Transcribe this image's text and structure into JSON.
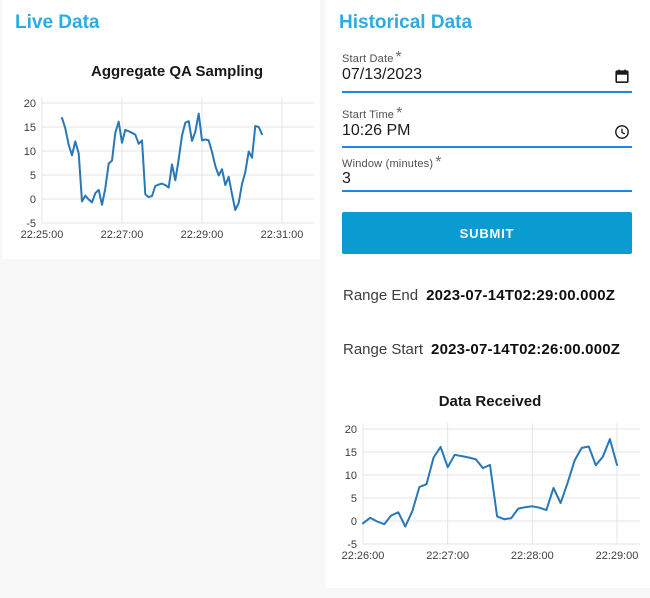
{
  "left_panel": {
    "heading": "Live Data"
  },
  "right_panel": {
    "heading": "Historical Data",
    "form": {
      "start_date": {
        "label": "Start Date",
        "required_marker": "*",
        "value": "07/13/2023"
      },
      "start_time": {
        "label": "Start Time",
        "required_marker": "*",
        "value": "10:26 PM"
      },
      "window": {
        "label": "Window (minutes)",
        "required_marker": "*",
        "value": "3"
      },
      "submit_label": "SUBMIT"
    },
    "range_end": {
      "label": "Range End",
      "value": "2023-07-14T02:29:00.000Z"
    },
    "range_start": {
      "label": "Range Start",
      "value": "2023-07-14T02:26:00.000Z"
    }
  },
  "icons": {
    "date_picker": "calendar-icon",
    "time_picker": "clock-icon"
  },
  "colors": {
    "heading_accent": "#2bace3",
    "underline_accent": "#1e88e5",
    "submit_bg": "#0a9bd0",
    "submit_text": "#ffffff",
    "chart_line": "#2878b8",
    "grid_line": "#e4e4e4",
    "page_bg": "#f8f8f8",
    "card_bg": "#ffffff"
  },
  "chart_data": [
    {
      "type": "line",
      "name": "aggregate-qa-sampling",
      "title": "Aggregate QA Sampling",
      "start_time": "22:25:30",
      "interval_seconds": 5,
      "x_range": [
        "22:25:00",
        "22:31:00"
      ],
      "x_ticks": [
        "22:25:00",
        "22:27:00",
        "22:29:00",
        "22:31:00"
      ],
      "y_ticks": [
        20,
        15,
        10,
        5,
        0,
        -5
      ],
      "y_range": [
        -5,
        20
      ],
      "line_color": "#2878b8",
      "values": [
        16.9,
        14.7,
        11.3,
        9.1,
        12.0,
        9.5,
        -0.5,
        0.7,
        -0.1,
        -0.7,
        1.2,
        1.9,
        -1.2,
        2.2,
        7.4,
        8.0,
        13.8,
        16.1,
        11.7,
        14.4,
        14.1,
        13.8,
        13.4,
        11.5,
        12.2,
        1.0,
        0.4,
        0.6,
        2.7,
        3.0,
        3.2,
        2.9,
        2.4,
        7.2,
        3.9,
        8.3,
        13.2,
        15.9,
        16.2,
        12.1,
        14.0,
        17.8,
        12.2,
        12.4,
        12.2,
        9.8,
        6.9,
        4.9,
        6.2,
        2.9,
        4.6,
        1.0,
        -2.3,
        -0.8,
        3.1,
        5.6,
        9.9,
        8.6,
        15.2,
        15.0,
        13.5
      ]
    },
    {
      "type": "line",
      "name": "data-received",
      "title": "Data Received",
      "start_time": "22:26:00",
      "interval_seconds": 5,
      "x_range": [
        "22:26:00",
        "22:29:00"
      ],
      "x_ticks": [
        "22:26:00",
        "22:27:00",
        "22:28:00",
        "22:29:00"
      ],
      "y_ticks": [
        20,
        15,
        10,
        5,
        0,
        -5
      ],
      "y_range": [
        -5,
        20
      ],
      "line_color": "#2878b8",
      "values": [
        -0.5,
        0.7,
        -0.1,
        -0.7,
        1.2,
        1.9,
        -1.2,
        2.2,
        7.4,
        8.0,
        13.8,
        16.1,
        11.7,
        14.4,
        14.1,
        13.8,
        13.4,
        11.5,
        12.2,
        1.0,
        0.4,
        0.6,
        2.7,
        3.0,
        3.2,
        2.9,
        2.4,
        7.2,
        3.9,
        8.3,
        13.2,
        15.9,
        16.2,
        12.1,
        14.0,
        17.8,
        12.2
      ]
    }
  ]
}
